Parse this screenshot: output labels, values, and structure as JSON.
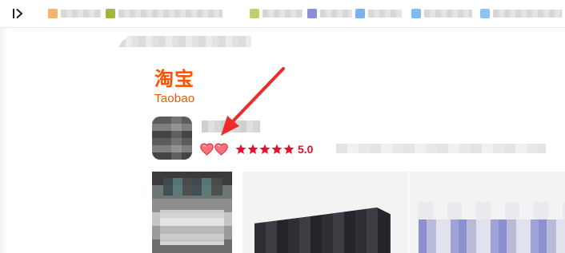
{
  "browser": {
    "bookmarks_toggle_icon": "sidebar-expand-icon",
    "bookmarks": [
      {
        "icon_color": "#f6b36b",
        "label": ""
      },
      {
        "icon_color": "#d6d6d6",
        "label": ""
      },
      {
        "icon_color": "#9fba3b",
        "label": ""
      },
      {
        "icon_color": "#d8d8d8",
        "label": ""
      },
      {
        "icon_color": "#c4cf6a",
        "label": ""
      },
      {
        "icon_color": "#8a8fd8",
        "label": ""
      },
      {
        "icon_color": "#7ab3f0",
        "label": ""
      },
      {
        "icon_color": "#7fbcf4",
        "label": ""
      },
      {
        "icon_color": "#8ec2f5",
        "label": ""
      }
    ]
  },
  "shop": {
    "logo_cn": "淘宝",
    "logo_en": "Taobao",
    "brand_color": "#ff5000",
    "seller_rating": {
      "hearts": 2,
      "heart_icon": "heart-icon",
      "stars": 5,
      "star_icon": "star-icon",
      "score": "5.0",
      "accent_color": "#e0102a"
    }
  },
  "annotation": {
    "type": "arrow",
    "color": "#ee2a2a",
    "points_to": "seller-rating-hearts"
  }
}
